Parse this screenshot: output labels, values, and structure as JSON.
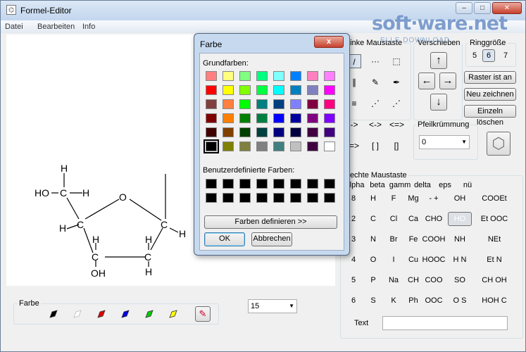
{
  "window": {
    "title": "Formel-Editor",
    "min": "–",
    "max": "□",
    "close": "✕"
  },
  "watermark": {
    "brand": "soft·ware.net",
    "tag": "ELLE DOWNLOAD"
  },
  "menu": [
    "Datei",
    "Bearbeiten",
    "Info"
  ],
  "molecule": {
    "atoms": [
      "H",
      "HO",
      "C",
      "H",
      "O",
      "H",
      "C",
      "C",
      "H",
      "C",
      "H",
      "OH",
      "C",
      "H",
      "H"
    ]
  },
  "bottom": {
    "farbe_label": "Farbe",
    "pen_colors": [
      "#000000",
      "#ffffff",
      "#e00000",
      "#0000dd",
      "#00cc00",
      "#ffff00"
    ],
    "size_value": "15",
    "size_arrow": "▼"
  },
  "right": {
    "linke_label": "Linke Maustaste",
    "verschieben_label": "Verschieben",
    "ringgroesse_label": "Ringgröße",
    "ring_values": [
      "5",
      "6",
      "7"
    ],
    "raster_label": "Raster ist an",
    "neu_label": "Neu zeichnen",
    "einzeln_label": "Einzeln löschen",
    "arrows": [
      "↑",
      "←",
      "→",
      "↓"
    ],
    "tools": [
      "/",
      "···",
      "⬚",
      "∥",
      "✎",
      "✒",
      "≡",
      "⋰",
      "⋰",
      "->",
      "<->",
      "<=>",
      "=>",
      "[ ]",
      "[]"
    ],
    "pfeil_label": "Pfeilkrümmung",
    "pfeil_value": "0",
    "hex_icon": "⬡",
    "rechte_label": "Rechte Maustaste",
    "greek": [
      "alpha",
      "beta",
      "gamm",
      "delta",
      "eps",
      "nü"
    ],
    "grid": [
      [
        "8",
        "H",
        "F",
        "Mg",
        "-  +",
        "OH",
        "COOEt"
      ],
      [
        "2",
        "C",
        "Cl",
        "Ca",
        "CHO",
        "HO",
        "Et OOC"
      ],
      [
        "3",
        "N",
        "Br",
        "Fe",
        "COOH",
        "NH",
        "NEt"
      ],
      [
        "4",
        "O",
        "I",
        "Cu",
        "HOOC",
        "H N",
        "Et N"
      ],
      [
        "5",
        "P",
        "Na",
        "CH",
        "COO",
        "SO",
        "CH OH"
      ],
      [
        "6",
        "S",
        "K",
        "Ph",
        "OOC",
        "O S",
        "HOH C"
      ]
    ],
    "text_label": "Text",
    "text_value": ""
  },
  "dialog": {
    "title": "Farbe",
    "close": "x",
    "grund_label": "Grundfarben:",
    "basic_colors": [
      [
        "#ff8080",
        "#ffff80",
        "#80ff80",
        "#00ff80",
        "#80ffff",
        "#0080ff",
        "#ff80c0",
        "#ff80ff"
      ],
      [
        "#ff0000",
        "#ffff00",
        "#80ff00",
        "#00ff40",
        "#00ffff",
        "#0080c0",
        "#8080c0",
        "#ff00ff"
      ],
      [
        "#804040",
        "#ff8040",
        "#00ff00",
        "#008080",
        "#004080",
        "#8080ff",
        "#800040",
        "#ff0080"
      ],
      [
        "#800000",
        "#ff8000",
        "#008000",
        "#008040",
        "#0000ff",
        "#0000a0",
        "#800080",
        "#8000ff"
      ],
      [
        "#400000",
        "#804000",
        "#004000",
        "#004040",
        "#000080",
        "#000040",
        "#400040",
        "#400080"
      ],
      [
        "#000000",
        "#808000",
        "#808040",
        "#808080",
        "#408080",
        "#c0c0c0",
        "#400040",
        "#ffffff"
      ]
    ],
    "custom_label": "Benutzerdefinierte Farben:",
    "define_label": "Farben definieren >>",
    "ok_label": "OK",
    "cancel_label": "Abbrechen"
  }
}
